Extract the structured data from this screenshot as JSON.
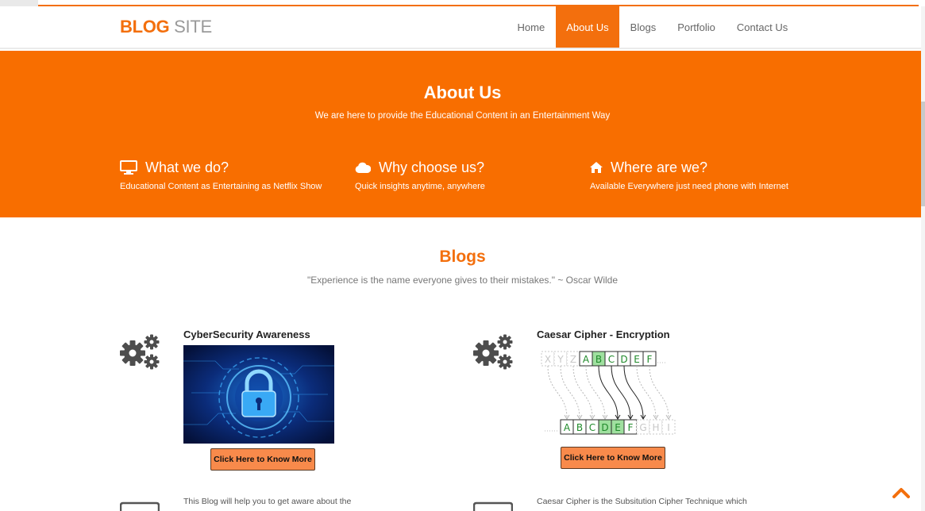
{
  "header": {
    "logo_bold": "BLOG",
    "logo_light": " SITE",
    "nav": [
      "Home",
      "About Us",
      "Blogs",
      "Portfolio",
      "Contact Us"
    ],
    "active_nav": "About Us"
  },
  "about": {
    "title": "About Us",
    "subtitle": "We are here to provide the Educational Content in an Entertainment Way",
    "features": [
      {
        "icon": "monitor-icon",
        "title": "What we do?",
        "desc": "Educational Content as Entertaining as Netflix Show"
      },
      {
        "icon": "cloud-icon",
        "title": "Why choose us?",
        "desc": "Quick insights anytime, anywhere"
      },
      {
        "icon": "home-icon",
        "title": "Where are we?",
        "desc": "Available Everywhere just need phone with Internet"
      }
    ]
  },
  "blogs": {
    "title": "Blogs",
    "quote": "\"Experience is the name everyone gives to their mistakes.\" ~ Oscar Wilde",
    "posts": [
      {
        "title": "CyberSecurity Awareness",
        "button": "Click Here to Know More",
        "desc": "This Blog will help you to get aware about the"
      },
      {
        "title": "Caesar Cipher - Encryption",
        "button": "Click Here to Know More",
        "desc": "Caesar Cipher is the Subsitution Cipher Technique which"
      }
    ]
  },
  "cipher": {
    "top": [
      "X",
      "Y",
      "Z",
      "A",
      "B",
      "C",
      "D",
      "E",
      "F"
    ],
    "bottom": [
      "A",
      "B",
      "C",
      "D",
      "E",
      "F",
      "G",
      "H",
      "I"
    ]
  },
  "colors": {
    "accent": "#f36f0d",
    "hero": "#f86e00",
    "button": "#f88a4b"
  }
}
